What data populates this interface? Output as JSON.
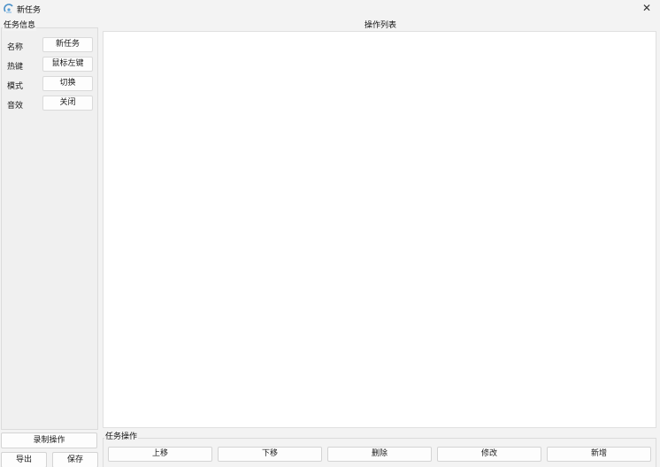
{
  "window": {
    "title": "新任务",
    "close_glyph": "✕",
    "icon": "app-logo-icon"
  },
  "task_info": {
    "title": "任务信息",
    "rows": [
      {
        "label": "名称",
        "value": "新任务"
      },
      {
        "label": "热键",
        "value": "鼠标左键"
      },
      {
        "label": "模式",
        "value": "切换"
      },
      {
        "label": "音效",
        "value": "关闭"
      }
    ]
  },
  "operation_list": {
    "title": "操作列表",
    "items": []
  },
  "left_actions": {
    "record_label": "录制操作",
    "export_label": "导出",
    "save_label": "保存"
  },
  "task_ops": {
    "title": "任务操作",
    "move_up_label": "上移",
    "move_down_label": "下移",
    "delete_label": "删除",
    "modify_label": "修改",
    "add_label": "新增"
  },
  "colors": {
    "background": "#f3f3f3",
    "panel": "#ffffff",
    "border": "#dcdcdc"
  }
}
